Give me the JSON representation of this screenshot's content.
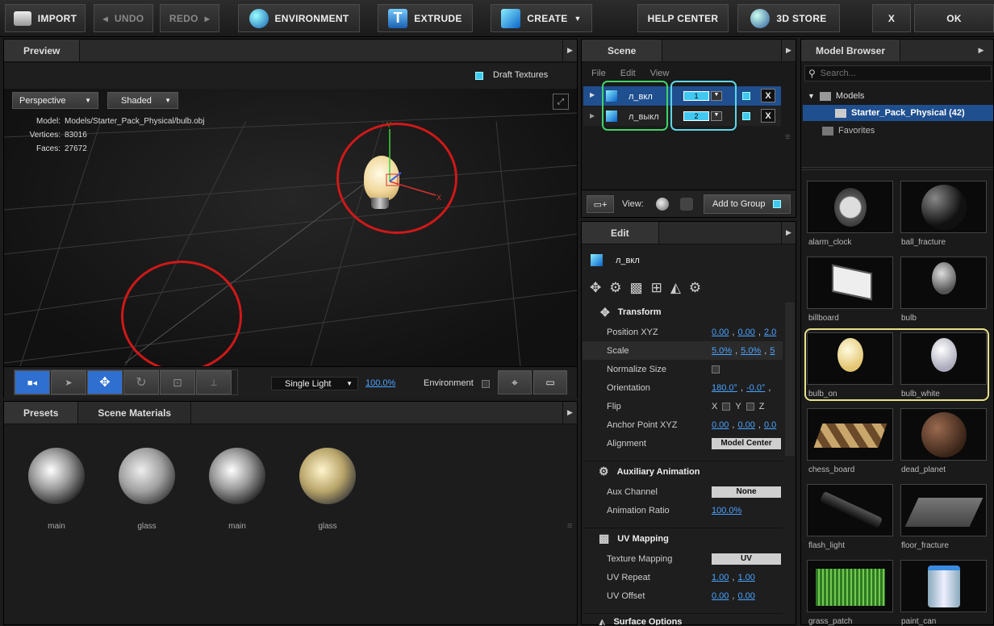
{
  "toolbar": {
    "import": "IMPORT",
    "undo": "UNDO",
    "redo": "REDO",
    "environment": "ENVIRONMENT",
    "extrude": "EXTRUDE",
    "create": "CREATE",
    "help": "HELP CENTER",
    "store": "3D STORE",
    "close": "X",
    "ok": "OK"
  },
  "preview": {
    "tab": "Preview",
    "draft": "Draft Textures",
    "camera": "Perspective",
    "shading": "Shaded",
    "model_label": "Model:",
    "model_value": "Models/Starter_Pack_Physical/bulb.obj",
    "vertices_label": "Vertices:",
    "vertices_value": "83016",
    "faces_label": "Faces:",
    "faces_value": "27672",
    "light": "Single Light",
    "zoom": "100.0%",
    "environment": "Environment",
    "axis_y": "Y",
    "axis_x": "X"
  },
  "materials": {
    "tabs": [
      "Presets",
      "Scene Materials"
    ],
    "items": [
      "main",
      "glass",
      "main",
      "glass"
    ]
  },
  "scene": {
    "tab": "Scene",
    "menu": [
      "File",
      "Edit",
      "View"
    ],
    "rows": [
      {
        "name": "л_вкл",
        "group": "1",
        "close": "X"
      },
      {
        "name": "л_выкл",
        "group": "2",
        "close": "X"
      }
    ],
    "view_label": "View:",
    "add_group": "Add to Group"
  },
  "edit": {
    "tab": "Edit",
    "object": "л_вкл",
    "transform": {
      "title": "Transform",
      "position": "Position XYZ",
      "position_vals": [
        "0.00",
        "0.00",
        "2.0"
      ],
      "scale": "Scale",
      "scale_vals": [
        "5.0%",
        "5.0%",
        "5"
      ],
      "normalize": "Normalize Size",
      "orientation": "Orientation",
      "orientation_vals": [
        "180.0°",
        "-0.0°"
      ],
      "flip": "Flip",
      "flip_axes": [
        "X",
        "Y",
        "Z"
      ],
      "anchor": "Anchor Point XYZ",
      "anchor_vals": [
        "0.00",
        "0.00",
        "0.0"
      ],
      "alignment": "Alignment",
      "alignment_val": "Model Center"
    },
    "aux": {
      "title": "Auxiliary Animation",
      "channel": "Aux Channel",
      "channel_val": "None",
      "ratio": "Animation Ratio",
      "ratio_val": "100.0%"
    },
    "uv": {
      "title": "UV Mapping",
      "mapping": "Texture Mapping",
      "mapping_val": "UV",
      "repeat": "UV Repeat",
      "repeat_vals": [
        "1.00",
        "1.00"
      ],
      "offset": "UV Offset",
      "offset_vals": [
        "0.00",
        "0.00"
      ]
    },
    "surface": {
      "title": "Surface Options"
    }
  },
  "browser": {
    "tab": "Model Browser",
    "search_placeholder": "Search...",
    "tree": {
      "models": "Models",
      "pack": "Starter_Pack_Physical (42)",
      "favorites": "Favorites"
    },
    "items": [
      "alarm_clock",
      "ball_fracture",
      "billboard",
      "bulb",
      "bulb_on",
      "bulb_white",
      "chess_board",
      "dead_planet",
      "flash_light",
      "floor_fracture",
      "grass_patch",
      "paint_can"
    ]
  },
  "colors": {
    "accent": "#4aa3ff",
    "selected_row": "#1f4f8f",
    "highlight_green": "#3fd36a",
    "highlight_cyan": "#5fd6e8",
    "highlight_yellow": "#e8e08a",
    "highlight_red": "#d01818"
  }
}
